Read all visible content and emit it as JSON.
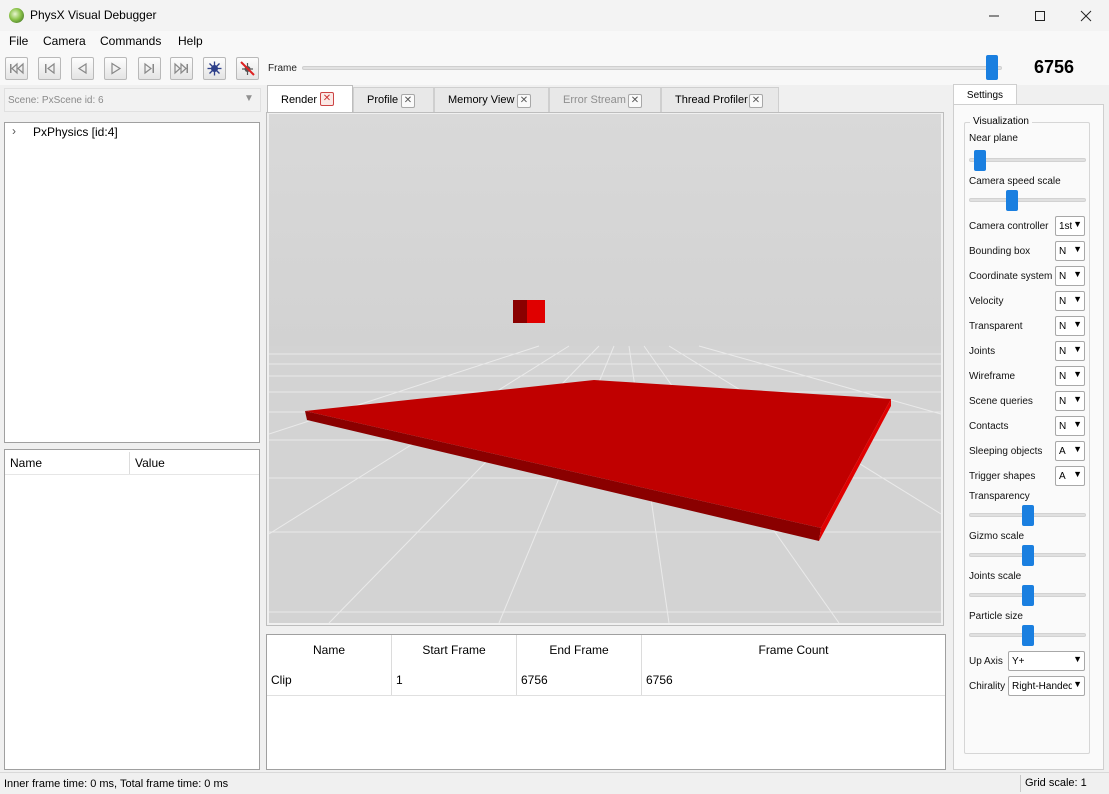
{
  "window": {
    "title": "PhysX Visual Debugger"
  },
  "menu": [
    "File",
    "Camera",
    "Commands",
    "Help"
  ],
  "toolbar": {
    "buttons": [
      "skip-to-start",
      "step-back-far",
      "step-back",
      "play",
      "step-forward",
      "skip-to-end",
      "connect",
      "disconnect"
    ],
    "frame_label": "Frame",
    "frame_value": "6756",
    "frame_position": 1.0
  },
  "scene": {
    "selected": "Scene: PxScene id: 6"
  },
  "tree": {
    "items": [
      "PxPhysics [id:4]"
    ]
  },
  "properties": {
    "columns": [
      "Name",
      "Value"
    ]
  },
  "tabs": [
    {
      "label": "Render",
      "active": true,
      "enabled": true
    },
    {
      "label": "Profile",
      "active": false,
      "enabled": true
    },
    {
      "label": "Memory View",
      "active": false,
      "enabled": true
    },
    {
      "label": "Error Stream",
      "active": false,
      "enabled": false
    },
    {
      "label": "Thread Profiler",
      "active": false,
      "enabled": true
    }
  ],
  "viewport": {
    "sky_color": "#d6d6d6",
    "ground_color": "#d3d3d3",
    "object_color": "#c00000"
  },
  "clips": {
    "columns": [
      "Name",
      "Start Frame",
      "End Frame",
      "Frame Count"
    ],
    "rows": [
      [
        "Clip",
        "1",
        "6756",
        "6756"
      ]
    ]
  },
  "settings": {
    "tab_label": "Settings",
    "group_title": "Visualization",
    "near_plane": {
      "label": "Near plane",
      "level": 0.05
    },
    "camera_speed_scale": {
      "label": "Camera speed scale",
      "level": 0.35
    },
    "combos": [
      {
        "label": "Camera controller",
        "value": "1st"
      },
      {
        "label": "Bounding box",
        "value": "N"
      },
      {
        "label": "Coordinate system",
        "value": "N"
      },
      {
        "label": "Velocity",
        "value": "N"
      },
      {
        "label": "Transparent",
        "value": "N"
      },
      {
        "label": "Joints",
        "value": "N"
      },
      {
        "label": "Wireframe",
        "value": "N"
      },
      {
        "label": "Scene queries",
        "value": "N"
      },
      {
        "label": "Contacts",
        "value": "N"
      },
      {
        "label": "Sleeping objects",
        "value": "A"
      },
      {
        "label": "Trigger shapes",
        "value": "A"
      }
    ],
    "sliders": [
      {
        "label": "Transparency",
        "level": 0.5
      },
      {
        "label": "Gizmo scale",
        "level": 0.5
      },
      {
        "label": "Joints scale",
        "level": 0.5
      },
      {
        "label": "Particle size",
        "level": 0.5
      }
    ],
    "up_axis": {
      "label": "Up Axis",
      "value": "Y+"
    },
    "chirality": {
      "label": "Chirality",
      "value": "Right-Handed"
    }
  },
  "status": {
    "frame_time": "Inner frame time: 0 ms, Total frame time: 0 ms",
    "grid_scale": "Grid scale: 1"
  },
  "colors": {
    "accent": "#1a7fe0"
  }
}
